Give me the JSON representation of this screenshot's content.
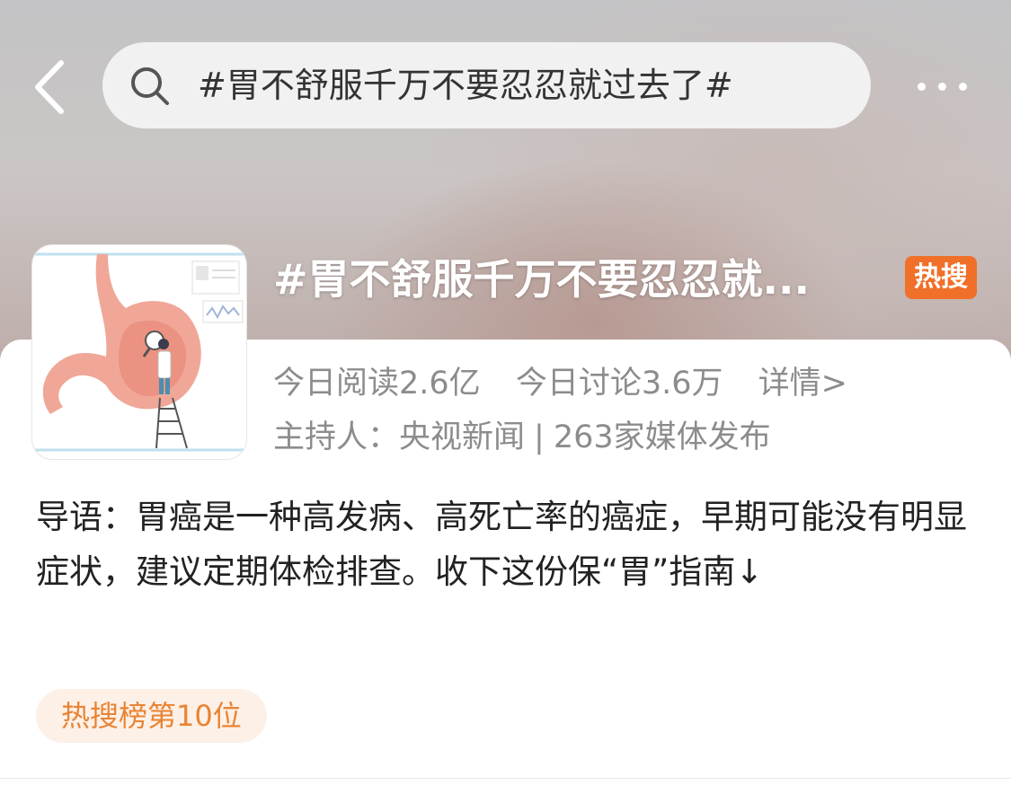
{
  "search": {
    "query": "#胃不舒服千万不要忍忍就过去了#"
  },
  "topic": {
    "title": "#胃不舒服千万不要忍忍就...",
    "badge": "热搜",
    "reads_today": "今日阅读2.6亿",
    "discussions_today": "今日讨论3.6万",
    "details_link": "详情>",
    "host_label": "主持人：央视新闻",
    "separator": "|",
    "media_count": "263家媒体发布",
    "intro": "导语：胃癌是一种高发病、高死亡率的癌症，早期可能没有明显症状，建议定期体检排查。收下这份保“胃”指南↓",
    "rank": "热搜榜第10位"
  },
  "icons": {
    "back": "back-arrow-icon",
    "search": "search-icon",
    "more": "more-dots-icon"
  },
  "colors": {
    "badge": "#f0702a",
    "rank_text": "#e88433",
    "rank_bg": "#fdf0e7",
    "meta_text": "#8c8c8c"
  }
}
